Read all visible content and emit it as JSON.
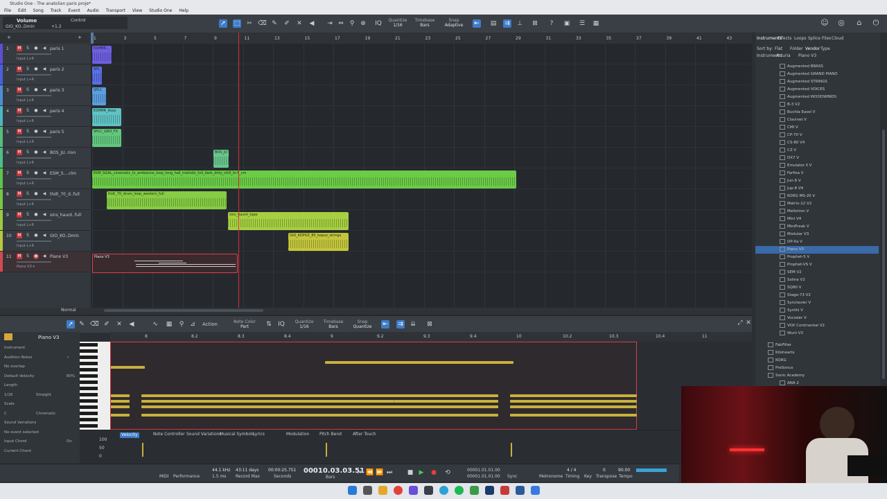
{
  "window": {
    "title": "Studio One - The anatolian paris proje*"
  },
  "menu": [
    "File",
    "Edit",
    "Song",
    "Track",
    "Event",
    "Audio",
    "Transport",
    "View",
    "Studio One",
    "Help"
  ],
  "toolbar": {
    "preset_name": "Volume",
    "preset_sub": "GIO_KO..Dmin",
    "preset_val": "+1.2",
    "control_label": "Control",
    "quantize_label": "Quantize",
    "quantize_value": "1/16",
    "timebase_label": "Timebase",
    "timebase_value": "Bars",
    "snap_label": "Snap",
    "snap_value": "Adaptive"
  },
  "ruler_marks": [
    "1",
    "3",
    "5",
    "7",
    "9",
    "11",
    "13",
    "15",
    "17",
    "19",
    "21",
    "23",
    "25",
    "27",
    "29",
    "31",
    "33",
    "35",
    "37",
    "39",
    "41",
    "43"
  ],
  "tracks": [
    {
      "num": "1",
      "name": "paris 1",
      "input": "Input L+R",
      "color": "#5b4fd6"
    },
    {
      "num": "2",
      "name": "paris 2",
      "input": "Input L+R",
      "color": "#4a5ee0"
    },
    {
      "num": "3",
      "name": "paris 3",
      "input": "Input L+R",
      "color": "#4a8ed8"
    },
    {
      "num": "4",
      "name": "paris 4",
      "input": "Input L+R",
      "color": "#4bb7c0"
    },
    {
      "num": "5",
      "name": "paris 5",
      "input": "Input L+R",
      "color": "#53c07a"
    },
    {
      "num": "6",
      "name": "BOS_JU..rion",
      "input": "Input L+R",
      "color": "#4fbf88"
    },
    {
      "num": "7",
      "name": "ESM_S....clm",
      "input": "Input L+R",
      "color": "#5cc44a"
    },
    {
      "num": "8",
      "name": "thdt_70_d..full",
      "input": "Input L+R",
      "color": "#78c844"
    },
    {
      "num": "9",
      "name": "sins_haunt..full",
      "input": "Input L+R",
      "color": "#9ccb40"
    },
    {
      "num": "10",
      "name": "GIO_KO..Dmin",
      "input": "Input L+R",
      "color": "#bcc63c"
    },
    {
      "num": "11",
      "name": "Piano V3",
      "input": "Piano V3 ▾",
      "color": "#d14a50"
    }
  ],
  "clips": [
    {
      "track": 0,
      "label": "KSHMR...",
      "color": "#6e5ee0"
    },
    {
      "track": 1,
      "label": "SPL",
      "color": "#5a6ee6"
    },
    {
      "track": 2,
      "label": "SPLC",
      "color": "#5b9ee0"
    },
    {
      "track": 3,
      "label": "KSHMR_Assa",
      "color": "#5fc2c4"
    },
    {
      "track": 4,
      "label": "SPLC_GRO_FX",
      "color": "#62c77e"
    },
    {
      "track": 5,
      "label": "BOS_JU",
      "color": "#68c58e"
    },
    {
      "track": 6,
      "label": "ESM_SGAL_cinematic_fx_ambiance_loop_long_hall_melodic_full_dark_dirty_chill_lo-fi_cm",
      "color": "#6ccb48"
    },
    {
      "track": 7,
      "label": "thdt_70_drum_loop_western_full",
      "color": "#86cc44"
    },
    {
      "track": 8,
      "label": "sins_haunt_tape",
      "color": "#a6cf42"
    },
    {
      "track": 9,
      "label": "GIO_KOPUZ_80_kopuz_strings",
      "color": "#c3c63c"
    },
    {
      "track": 10,
      "label": "Piano V3",
      "color": "#3a2a2e"
    }
  ],
  "editor": {
    "track_name": "Piano V3",
    "action_label": "Action",
    "note_color_label": "Note Color",
    "note_color_value": "Part",
    "quantize_label": "Quantize",
    "quantize_value": "1/16",
    "timebase_label": "Timebase",
    "timebase_value": "Bars",
    "snap_label": "Snap",
    "snap_value": "Quantize",
    "props": [
      {
        "label": "Instrument",
        "value": ""
      },
      {
        "label": "Audition Notes",
        "value": "✓"
      },
      {
        "label": "No overlap",
        "value": ""
      },
      {
        "label": "Default Velocity",
        "value": "80%"
      },
      {
        "label": "Length",
        "value": ""
      },
      {
        "label": "1/16",
        "value": "Straight"
      },
      {
        "label": "Scale",
        "value": ""
      },
      {
        "label": "C",
        "value": "Chromatic"
      },
      {
        "label": "Sound Variations",
        "value": ""
      },
      {
        "label": "No event selected",
        "value": ""
      },
      {
        "label": "Input Chord",
        "value": "Dn"
      },
      {
        "label": "Current Chord",
        "value": ""
      }
    ],
    "ruler_marks": [
      "8",
      "8.2",
      "8.3",
      "8.4",
      "9",
      "9.2",
      "9.3",
      "9.4",
      "10",
      "10.2",
      "10.3",
      "10.4",
      "11"
    ],
    "lanes": [
      "Velocity",
      "Note Controller",
      "Sound Variations",
      "Musical Symbols",
      "Lyrics",
      "Modulation",
      "Pitch Bend",
      "After Touch"
    ],
    "vel_scale": [
      "100",
      "50",
      "0"
    ]
  },
  "browser": {
    "tabs": [
      "Instruments",
      "Effects",
      "Loops",
      "Splice",
      "Files",
      "Cloud"
    ],
    "sort_by": "Sort by:",
    "sort_opts": [
      "Flat",
      "Folder",
      "Vendor",
      "Type"
    ],
    "breadcrumb": [
      "Instruments",
      "Arturia",
      "Piano V3"
    ],
    "items": [
      "Augmented BRASS",
      "Augmented GRAND PIANO",
      "Augmented STRINGS",
      "Augmented VOICES",
      "Augmented WOODWINDS",
      "B-3 V2",
      "Buchla Easel V",
      "Clavinet V",
      "CMI V",
      "CP-70 V",
      "CS-80 V4",
      "CZ V",
      "DX7 V",
      "Emulator II V",
      "Farfisa V",
      "Jun-6 V",
      "Jup-8 V4",
      "KORG MS-20 V",
      "Matrix-12 V2",
      "Mellotron V",
      "Mini V4",
      "MiniFreak V",
      "Modular V3",
      "OP-Xa V",
      "Piano V3",
      "Prophet-5 V",
      "Prophet-VS V",
      "SEM V2",
      "Solina V2",
      "SQ80 V",
      "Stage-73 V2",
      "Synclavier V",
      "Synthi V",
      "Vocoder V",
      "VOX Continental V2",
      "Wurli V3"
    ],
    "selected": "Piano V3",
    "folders": [
      "FabFilter",
      "Kilohearts",
      "KORG",
      "PreSonus",
      "Sonic Academy",
      "ANA 2"
    ]
  },
  "transport": {
    "sample_rate": "44.1 kHz",
    "latency": "1.5 ms",
    "record_max": "43:11 days",
    "record_label": "Record Max",
    "seconds": "00:00:25.751",
    "seconds_label": "Seconds",
    "position": "00010.03.03.51",
    "position_label": "Bars",
    "loop_start": "00001.01.01.00",
    "loop_end": "00001.01.01.00",
    "sync": "Sync",
    "metronome": "Metronome",
    "time_sig": "4 / 4",
    "timing": "Timing",
    "key_label": "Key",
    "transpose": "0",
    "transpose_label": "Transpose",
    "tempo": "90.00",
    "tempo_label": "Tempo",
    "midi_label": "MIDI",
    "perf_label": "Performance"
  },
  "statusbar": {
    "zoom_mode": "Normal"
  }
}
